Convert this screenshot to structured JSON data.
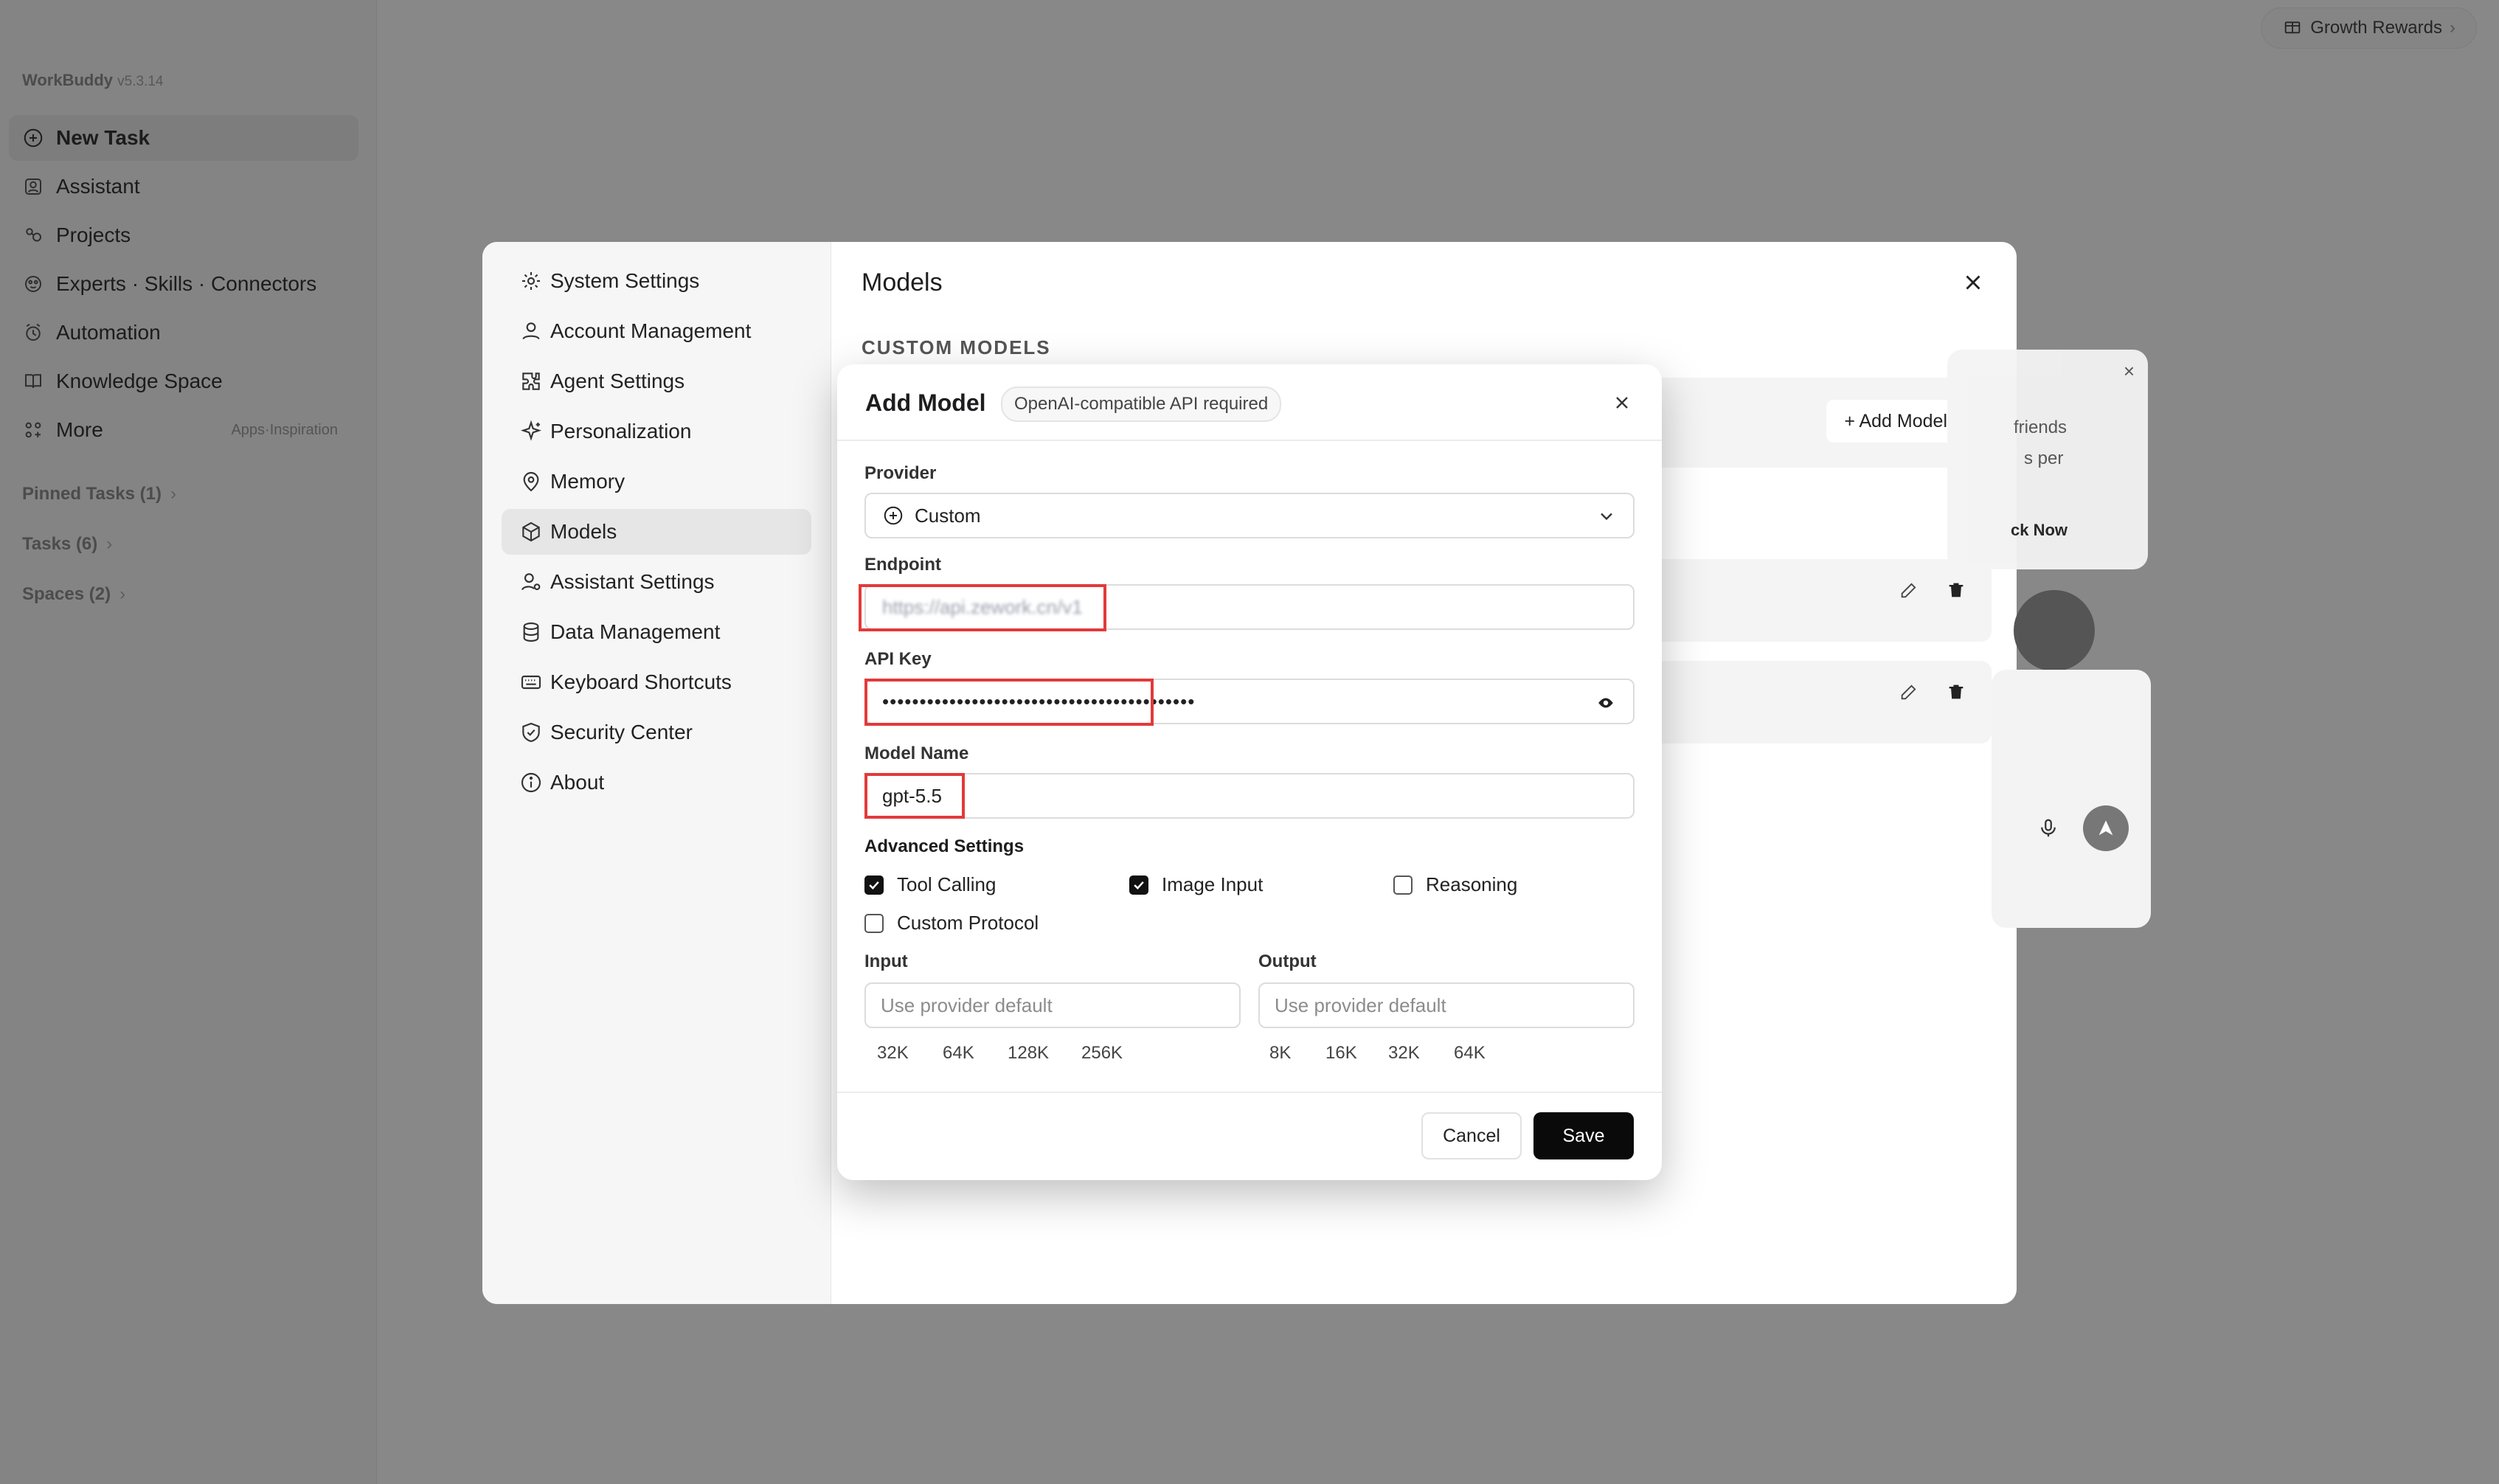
{
  "window": {
    "title": "WorkBuddy",
    "version": "v5.3.14"
  },
  "toolbar": {
    "growth_label": "Growth Rewards",
    "growth_chevron": "›"
  },
  "sidebar": {
    "items": [
      {
        "label": "New Task",
        "icon": "plus-circle-icon"
      },
      {
        "label": "Assistant",
        "icon": "assistant-icon"
      },
      {
        "label": "Projects",
        "icon": "projects-icon"
      },
      {
        "label": "Experts · Skills · Connectors",
        "icon": "experts-icon"
      },
      {
        "label": "Automation",
        "icon": "automation-icon"
      },
      {
        "label": "Knowledge Space",
        "icon": "book-icon"
      },
      {
        "label": "More",
        "icon": "grid-icon",
        "extra": "Apps·Inspiration"
      }
    ],
    "pinned": "Pinned Tasks (1)",
    "tasks": "Tasks (6)",
    "spaces": "Spaces (2)"
  },
  "settings": {
    "title": "Models",
    "section": "CUSTOM MODELS",
    "add_model_label": "+ Add Model",
    "menu": [
      {
        "label": "System Settings",
        "icon": "gear-icon"
      },
      {
        "label": "Account Management",
        "icon": "user-icon"
      },
      {
        "label": "Agent Settings",
        "icon": "puzzle-icon"
      },
      {
        "label": "Personalization",
        "icon": "sparkle-icon"
      },
      {
        "label": "Memory",
        "icon": "memory-icon"
      },
      {
        "label": "Models",
        "icon": "cube-icon",
        "active": true
      },
      {
        "label": "Assistant Settings",
        "icon": "user-gear-icon"
      },
      {
        "label": "Data Management",
        "icon": "database-icon"
      },
      {
        "label": "Keyboard Shortcuts",
        "icon": "keyboard-icon"
      },
      {
        "label": "Security Center",
        "icon": "shield-icon"
      },
      {
        "label": "About",
        "icon": "info-icon"
      }
    ]
  },
  "promo": {
    "line1": "friends",
    "line2": "s per",
    "cta": "ck Now"
  },
  "dialog": {
    "title": "Add Model",
    "badge": "OpenAI-compatible API required",
    "provider_label": "Provider",
    "provider_value": "Custom",
    "endpoint_label": "Endpoint",
    "endpoint_value": "https://api.zework.cn/v1",
    "apikey_label": "API Key",
    "apikey_value": "••••••••••••••••••••••••••••••••••••••••••",
    "model_label": "Model Name",
    "model_value": "gpt-5.5",
    "advanced_label": "Advanced Settings",
    "options": [
      {
        "label": "Tool Calling",
        "checked": true
      },
      {
        "label": "Image Input",
        "checked": true
      },
      {
        "label": "Reasoning",
        "checked": false
      },
      {
        "label": "Custom Protocol",
        "checked": false
      }
    ],
    "input_label": "Input",
    "output_label": "Output",
    "input_placeholder": "Use provider default",
    "output_placeholder": "Use provider default",
    "input_chips": [
      "32K",
      "64K",
      "128K",
      "256K"
    ],
    "output_chips": [
      "8K",
      "16K",
      "32K",
      "64K"
    ],
    "cancel_label": "Cancel",
    "save_label": "Save"
  },
  "colors": {
    "accent": "#0a0a0a",
    "highlight": "#e23a3a",
    "overlay": "#7a7a7a"
  }
}
